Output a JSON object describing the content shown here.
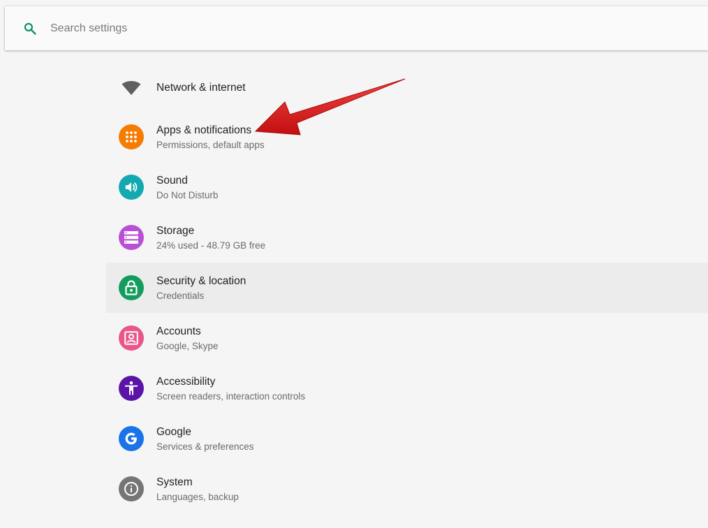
{
  "search": {
    "placeholder": "Search settings"
  },
  "colors": {
    "accent": "#0a8f5f",
    "apps": "#f57c00",
    "sound": "#12aab0",
    "storage": "#b94fd6",
    "security": "#129d5f",
    "accounts": "#e9568a",
    "accessibility": "#5b13a8",
    "google": "#1a73e8",
    "system": "#757575",
    "arrow": "#d61a1a"
  },
  "items": [
    {
      "title": "Network & internet",
      "subtitle": "",
      "icon": "wifi-icon"
    },
    {
      "title": "Apps & notifications",
      "subtitle": "Permissions, default apps",
      "icon": "apps-grid-icon"
    },
    {
      "title": "Sound",
      "subtitle": "Do Not Disturb",
      "icon": "volume-icon"
    },
    {
      "title": "Storage",
      "subtitle": "24% used - 48.79 GB free",
      "icon": "storage-icon"
    },
    {
      "title": "Security & location",
      "subtitle": "Credentials",
      "icon": "lock-icon"
    },
    {
      "title": "Accounts",
      "subtitle": "Google, Skype",
      "icon": "account-box-icon"
    },
    {
      "title": "Accessibility",
      "subtitle": "Screen readers, interaction controls",
      "icon": "accessibility-icon"
    },
    {
      "title": "Google",
      "subtitle": "Services & preferences",
      "icon": "google-g-icon"
    },
    {
      "title": "System",
      "subtitle": "Languages, backup",
      "icon": "info-icon"
    }
  ]
}
